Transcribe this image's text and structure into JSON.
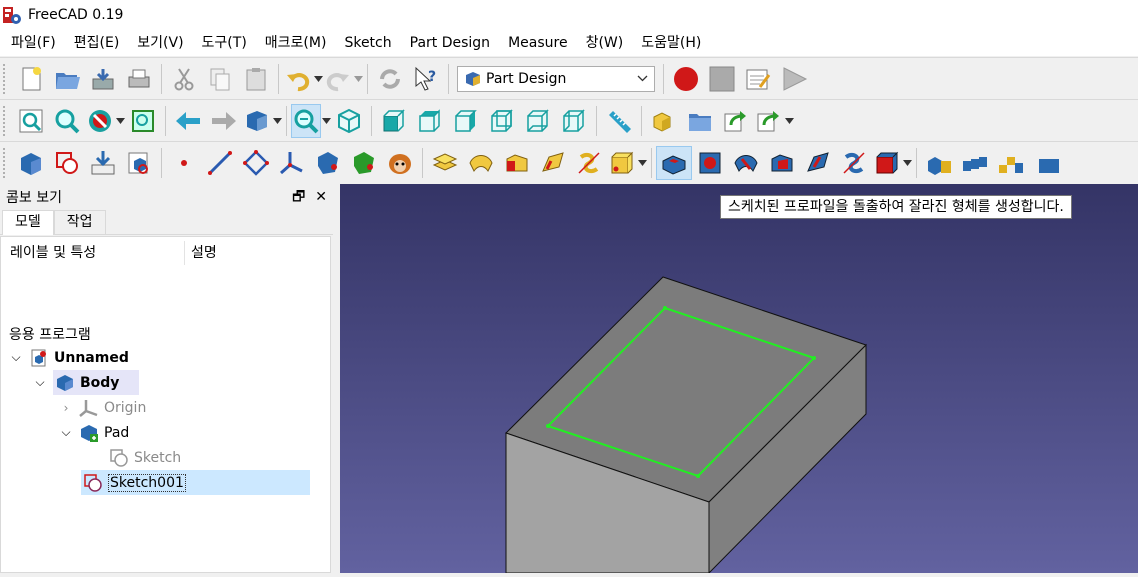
{
  "window": {
    "title": "FreeCAD 0.19"
  },
  "menu": [
    "파일(F)",
    "편집(E)",
    "보기(V)",
    "도구(T)",
    "매크로(M)",
    "Sketch",
    "Part Design",
    "Measure",
    "창(W)",
    "도움말(H)"
  ],
  "toolbar": {
    "workbench": "Part Design"
  },
  "panel": {
    "title": "콤보 보기",
    "tabs": [
      "모델",
      "작업"
    ],
    "columns": [
      "레이블 및 특성",
      "설명"
    ],
    "app_label": "응용 프로그램",
    "tree": [
      {
        "label": "Unnamed",
        "icon": "document-icon",
        "bold": true
      },
      {
        "label": "Body",
        "icon": "body-icon",
        "bold": true
      },
      {
        "label": "Origin",
        "icon": "origin-icon",
        "dim": true
      },
      {
        "label": "Pad",
        "icon": "pad-icon"
      },
      {
        "label": "Sketch",
        "icon": "sketch-icon",
        "dim": true
      },
      {
        "label": "Sketch001",
        "icon": "sketch-icon",
        "selected": true
      }
    ]
  },
  "tooltip": "스케치된 프로파일을 돌출하여 잘라진 형체를 생성합니다.",
  "colors": {
    "viewport_top": "#343466",
    "viewport_bottom": "#6262a0",
    "sketch_line": "#22ee22",
    "selection": "#cce8ff"
  }
}
